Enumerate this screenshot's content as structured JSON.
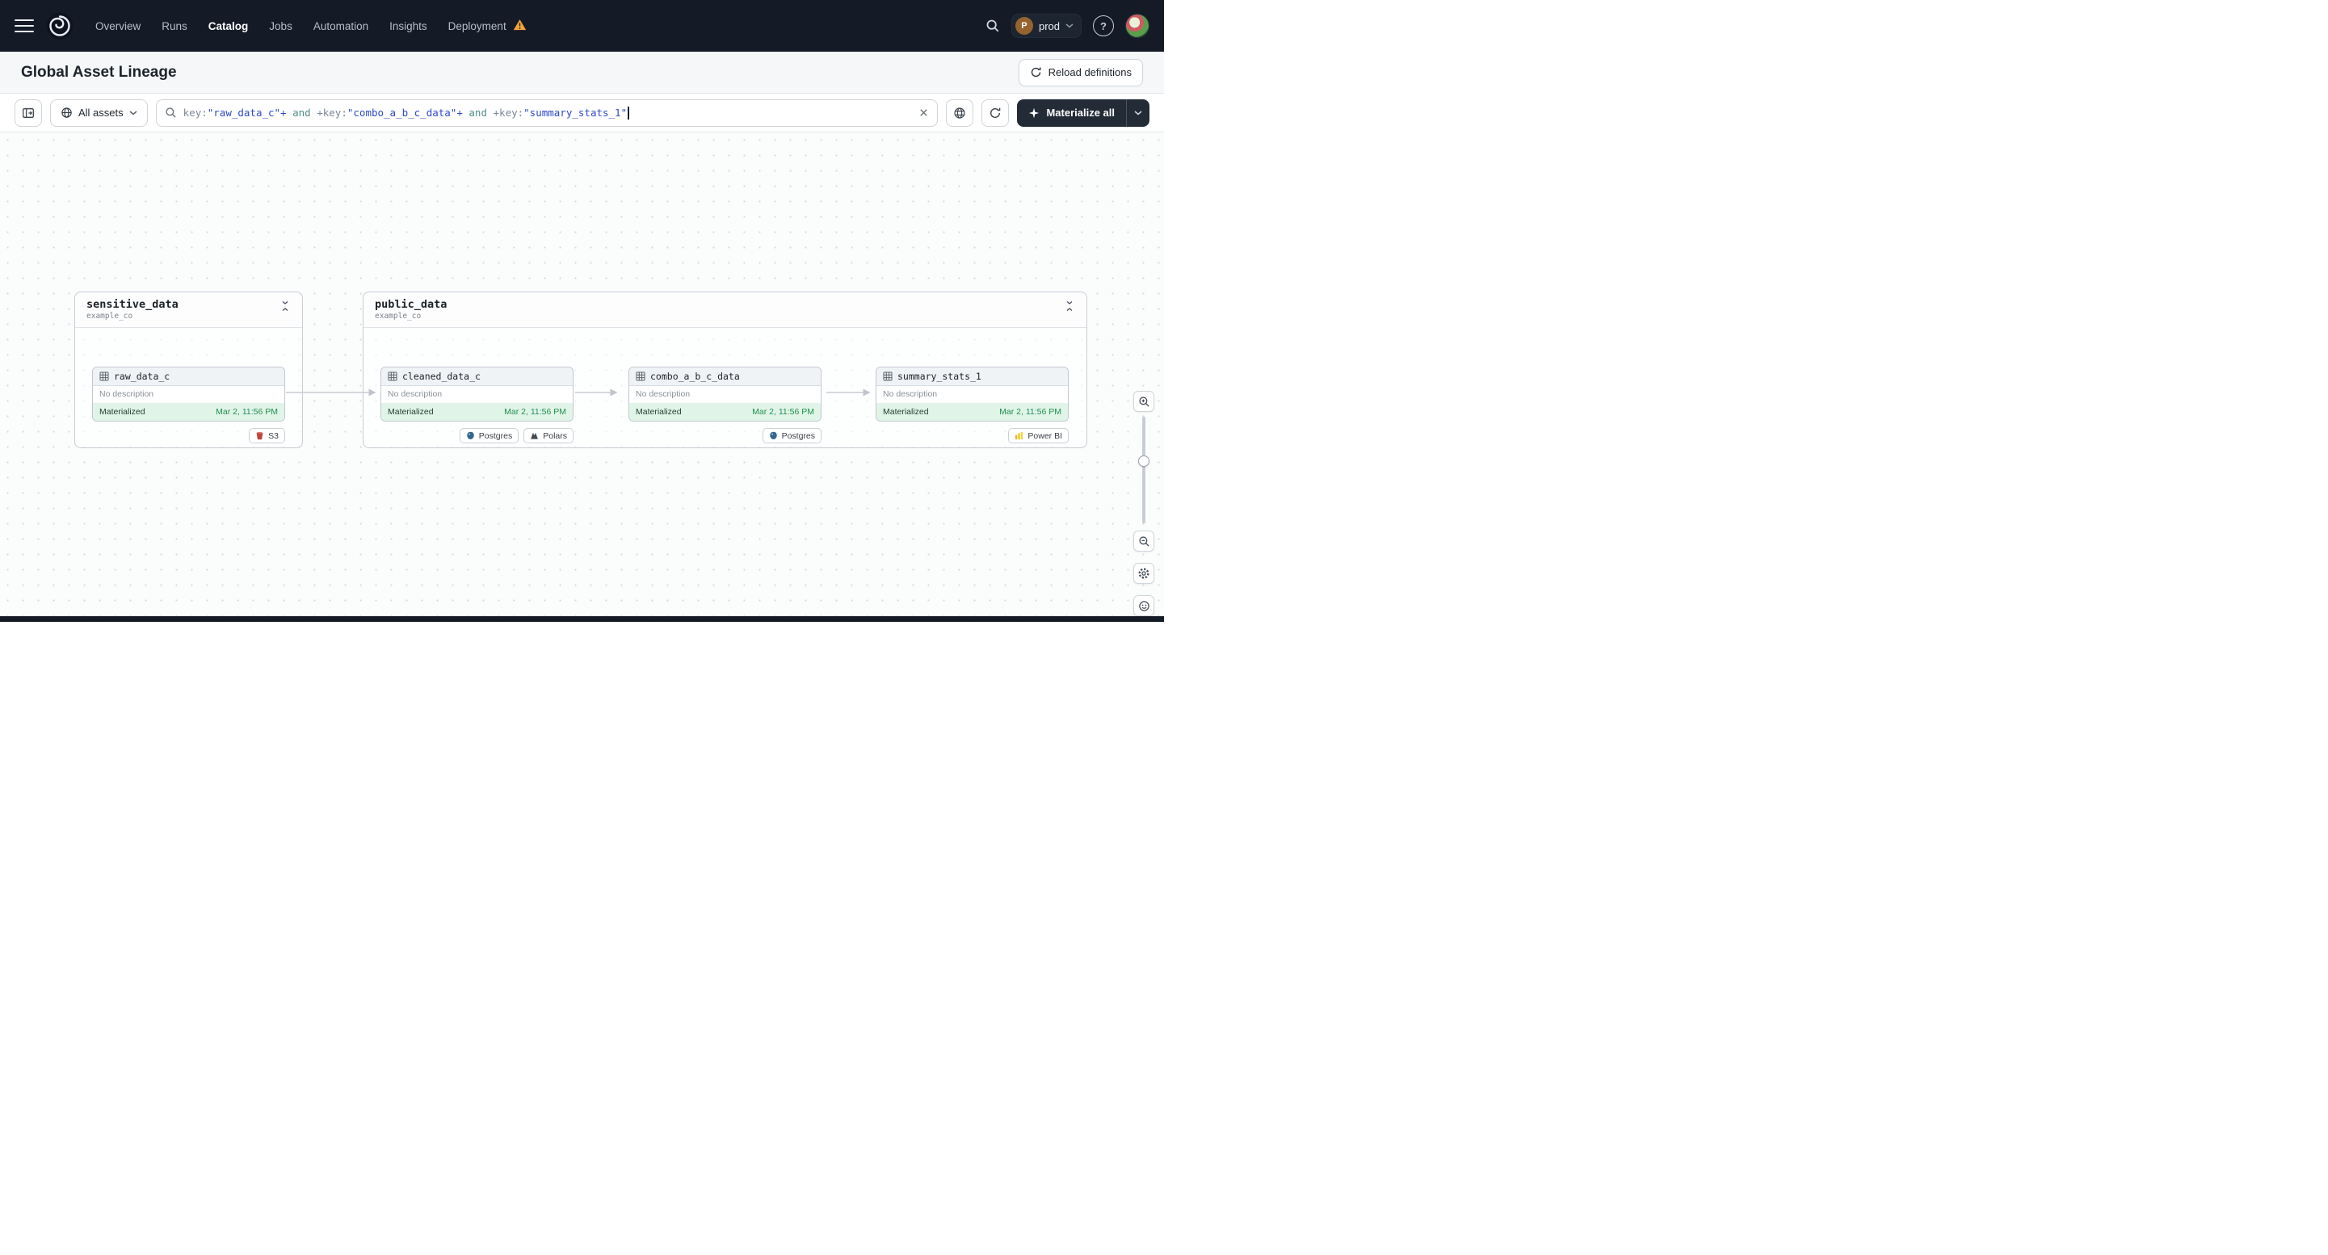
{
  "colors": {
    "nav_bg": "#151b26",
    "accent_green": "#1f9150",
    "status_bg": "#e1f4e8",
    "warning_orange": "#f2a33c",
    "query_key": "#7d879c",
    "query_string": "#2d49c9",
    "query_keyword": "#4f8f8b",
    "materialize_bg": "#222b36"
  },
  "icons": {
    "s3": "red bucket",
    "postgres": "blue elephant",
    "polars": "dark bear mark",
    "powerbi": "yellow bar chart",
    "deployment_warning": "orange warning triangle"
  },
  "nav": {
    "items": [
      {
        "label": "Overview"
      },
      {
        "label": "Runs"
      },
      {
        "label": "Catalog"
      },
      {
        "label": "Jobs"
      },
      {
        "label": "Automation"
      },
      {
        "label": "Insights"
      },
      {
        "label": "Deployment"
      }
    ],
    "active_item": "Catalog",
    "deployment_env": {
      "avatar_letter": "P",
      "label": "prod"
    },
    "help_label": "?"
  },
  "header": {
    "title": "Global Asset Lineage",
    "reload_button_label": "Reload definitions"
  },
  "toolbar": {
    "scope_label": "All assets",
    "materialize_label": "Materialize all",
    "query_segments": [
      {
        "text": "key:",
        "type": "key"
      },
      {
        "text": "\"raw_data_c\"+",
        "type": "string"
      },
      {
        "text": " and ",
        "type": "keyword"
      },
      {
        "text": "+key:",
        "type": "key"
      },
      {
        "text": "\"combo_a_b_c_data\"+",
        "type": "string"
      },
      {
        "text": " and ",
        "type": "keyword"
      },
      {
        "text": "+key:",
        "type": "key"
      },
      {
        "text": "\"summary_stats_1\"",
        "type": "string"
      }
    ]
  },
  "graph": {
    "groups": [
      {
        "name": "sensitive_data",
        "subtitle": "example_co",
        "assets": [
          {
            "name": "raw_data_c",
            "description": "No description",
            "status": "Materialized",
            "materialized_at": "Mar 2, 11:56 PM",
            "tags": [
              {
                "label": "S3",
                "icon": "s3-icon"
              }
            ]
          }
        ]
      },
      {
        "name": "public_data",
        "subtitle": "example_co",
        "assets": [
          {
            "name": "cleaned_data_c",
            "description": "No description",
            "status": "Materialized",
            "materialized_at": "Mar 2, 11:56 PM",
            "tags": [
              {
                "label": "Postgres",
                "icon": "postgres-icon"
              },
              {
                "label": "Polars",
                "icon": "polars-icon"
              }
            ]
          },
          {
            "name": "combo_a_b_c_data",
            "description": "No description",
            "status": "Materialized",
            "materialized_at": "Mar 2, 11:56 PM",
            "tags": [
              {
                "label": "Postgres",
                "icon": "postgres-icon"
              }
            ]
          },
          {
            "name": "summary_stats_1",
            "description": "No description",
            "status": "Materialized",
            "materialized_at": "Mar 2, 11:56 PM",
            "tags": [
              {
                "label": "Power BI",
                "icon": "powerbi-icon"
              }
            ]
          }
        ]
      }
    ]
  }
}
